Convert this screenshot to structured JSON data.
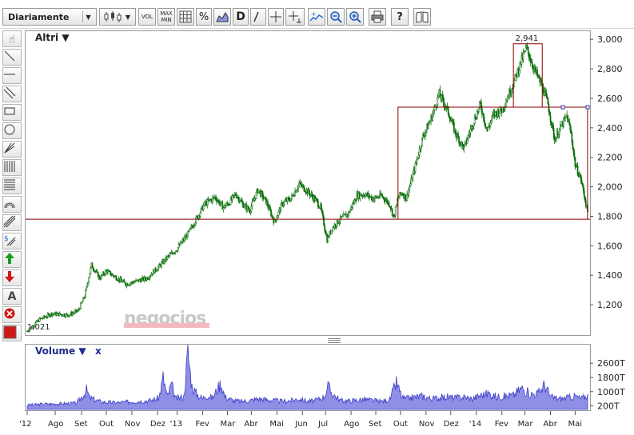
{
  "toolbar": {
    "period": "Diariamente",
    "buttons": [
      "VOL",
      "MAX MIN",
      "%",
      "D"
    ]
  },
  "price_panel": {
    "label": "Altri ▼"
  },
  "volume_panel": {
    "label": "Volume ▼",
    "close": "x"
  },
  "watermark": "negocios",
  "colors": {
    "candle": "#0a6e0a",
    "line": "#8b0000",
    "volume": "#3e3ec8"
  },
  "chart_data": [
    {
      "type": "line",
      "title": "",
      "xlabel": "",
      "ylabel": "",
      "ylim": [
        1000,
        3050
      ],
      "y_ticks": [
        "3,000",
        "2,800",
        "2,600",
        "2,400",
        "2,200",
        "2,000",
        "1,800",
        "1,600",
        "1,400",
        "1,200"
      ],
      "y_tick_values": [
        3000,
        2800,
        2600,
        2400,
        2200,
        2000,
        1800,
        1600,
        1400,
        1200
      ],
      "x_labels": [
        "'12",
        "Ago",
        "Set",
        "Out",
        "Nov",
        "Dez",
        "'13",
        "Fev",
        "Mar",
        "Abr",
        "Mai",
        "Jun",
        "Jul",
        "Ago",
        "Set",
        "Out",
        "Nov",
        "Dez",
        "'14",
        "Fev",
        "Mar",
        "Abr",
        "Mai"
      ],
      "x_label_days": [
        0,
        34,
        66,
        96,
        127,
        158,
        182,
        213,
        243,
        272,
        303,
        334,
        362,
        393,
        423,
        453,
        484,
        514,
        545,
        576,
        604,
        635,
        665
      ],
      "annotations": [
        "2,941",
        "1,021"
      ],
      "series": [
        {
          "x": [
            0,
            15,
            30,
            50,
            62,
            70,
            78,
            88,
            96,
            120,
            145,
            160,
            170,
            182,
            195,
            205,
            215,
            228,
            238,
            245,
            253,
            262,
            270,
            280,
            290,
            300,
            310,
            320,
            330,
            340,
            350,
            356,
            360,
            364,
            370,
            380,
            390,
            400,
            410,
            420,
            430,
            440,
            445,
            450,
            455,
            460,
            470,
            480,
            490,
            500,
            510,
            520,
            530,
            540,
            550,
            558,
            566,
            576,
            590,
            600,
            606,
            615,
            625,
            632,
            640,
            650,
            655,
            660,
            665,
            672,
            680
          ],
          "values": [
            1021,
            1100,
            1140,
            1130,
            1160,
            1260,
            1470,
            1380,
            1430,
            1340,
            1380,
            1460,
            1520,
            1580,
            1680,
            1780,
            1880,
            1930,
            1860,
            1890,
            1950,
            1880,
            1840,
            1980,
            1900,
            1760,
            1890,
            1920,
            2020,
            1970,
            1910,
            1860,
            1750,
            1640,
            1720,
            1780,
            1820,
            1940,
            1950,
            1920,
            1940,
            1880,
            1790,
            1930,
            1960,
            1920,
            2120,
            2340,
            2460,
            2630,
            2520,
            2360,
            2260,
            2420,
            2560,
            2380,
            2490,
            2520,
            2700,
            2860,
            2941,
            2800,
            2680,
            2560,
            2320,
            2430,
            2480,
            2360,
            2150,
            2050,
            1830
          ]
        }
      ],
      "guides": {
        "horizontal_level": 1780,
        "range_box": {
          "x0": 450,
          "x1": 680,
          "y": 2540
        },
        "peak_box": {
          "x0": 590,
          "x1": 625,
          "y": 2970
        }
      },
      "grid": false
    },
    {
      "type": "area",
      "title": "",
      "ylim": [
        0,
        3600
      ],
      "y_ticks": [
        "2600T",
        "1800T",
        "1000T",
        "200T"
      ],
      "y_tick_values": [
        2600,
        1800,
        1000,
        200
      ],
      "series": [
        {
          "name": "Volume",
          "x": [
            0,
            20,
            40,
            60,
            70,
            72,
            76,
            90,
            110,
            130,
            150,
            160,
            165,
            170,
            175,
            180,
            190,
            195,
            200,
            205,
            210,
            213,
            216,
            225,
            235,
            240,
            245,
            250,
            260,
            270,
            280,
            290,
            300,
            310,
            320,
            330,
            340,
            350,
            360,
            365,
            370,
            380,
            390,
            400,
            410,
            420,
            430,
            440,
            448,
            455,
            460,
            470,
            480,
            490,
            500,
            510,
            520,
            530,
            540,
            550,
            560,
            570,
            580,
            590,
            600,
            610,
            620,
            628,
            635,
            645,
            655,
            665,
            672,
            680
          ],
          "values": [
            250,
            300,
            320,
            350,
            900,
            1100,
            650,
            420,
            380,
            450,
            500,
            650,
            1800,
            700,
            1400,
            600,
            700,
            3200,
            1300,
            900,
            700,
            600,
            800,
            650,
            1500,
            700,
            600,
            500,
            450,
            500,
            600,
            550,
            500,
            450,
            500,
            600,
            450,
            500,
            700,
            1300,
            900,
            500,
            480,
            520,
            560,
            500,
            450,
            550,
            1500,
            650,
            600,
            700,
            750,
            600,
            650,
            700,
            650,
            700,
            600,
            800,
            900,
            700,
            750,
            800,
            1200,
            850,
            900,
            1400,
            700,
            600,
            650,
            750,
            600,
            800
          ]
        }
      ]
    }
  ]
}
